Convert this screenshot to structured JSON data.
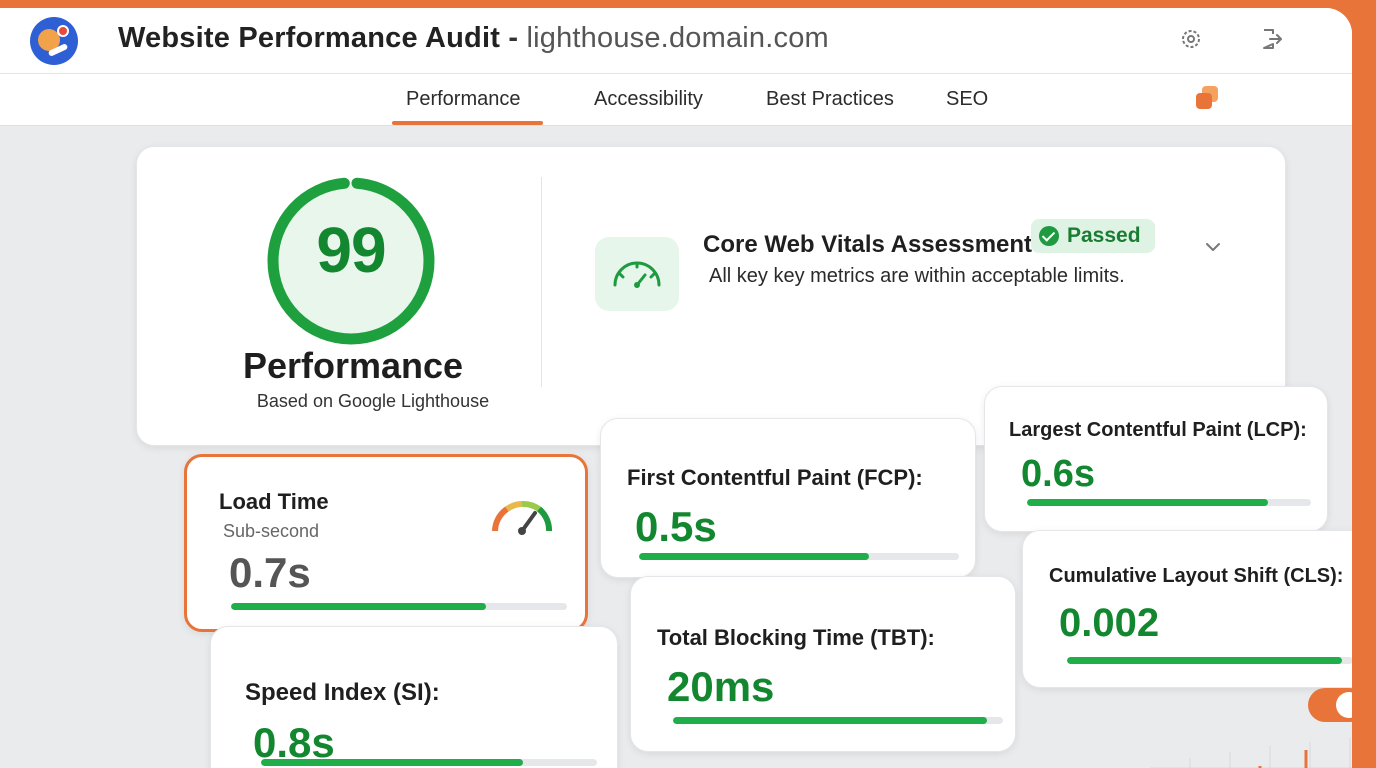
{
  "window": {
    "title_main": "Website Performance Audit",
    "title_sep": " - ",
    "title_domain": "lighthouse.domain.com",
    "icons": [
      "logo-icon",
      "settings-icon",
      "logout-icon",
      "layers-icon"
    ]
  },
  "tabs": [
    {
      "label": "Performance",
      "active": true
    },
    {
      "label": "Accessibility",
      "active": false
    },
    {
      "label": "Best Practices",
      "active": false
    },
    {
      "label": "SEO",
      "active": false
    }
  ],
  "summary": {
    "score": "99",
    "score_value": 0.99,
    "category": "Performance",
    "source": "Based on Google Lighthouse",
    "cwv_title": "Core Web Vitals Assessment",
    "cwv_status": "Passed",
    "cwv_description": "All key key metrics are within acceptable limits."
  },
  "metrics": {
    "load": {
      "label": "Load Time",
      "sub": "Sub-second",
      "value": "0.7s",
      "progress": 0.76,
      "color": "#555555"
    },
    "fcp": {
      "label": "First Contentful Paint (FCP):",
      "value": "0.5s",
      "progress": 0.72,
      "color": "#13872f"
    },
    "lcp": {
      "label": "Largest Contentful Paint (LCP):",
      "value": "0.6s",
      "progress": 0.85,
      "color": "#13872f"
    },
    "si": {
      "label": "Speed Index (SI):",
      "value": "0.8s",
      "progress": 0.78,
      "color": "#13872f"
    },
    "tbt": {
      "label": "Total Blocking Time (TBT):",
      "value": "20ms",
      "progress": 0.95,
      "color": "#13872f"
    },
    "cls": {
      "label": "Cumulative Layout Shift (CLS):",
      "value": "0.002",
      "progress": 0.96,
      "color": "#13872f"
    }
  },
  "theme": {
    "accent": "#e8743a",
    "good": "#1fae4a",
    "good_dark": "#13872f"
  }
}
